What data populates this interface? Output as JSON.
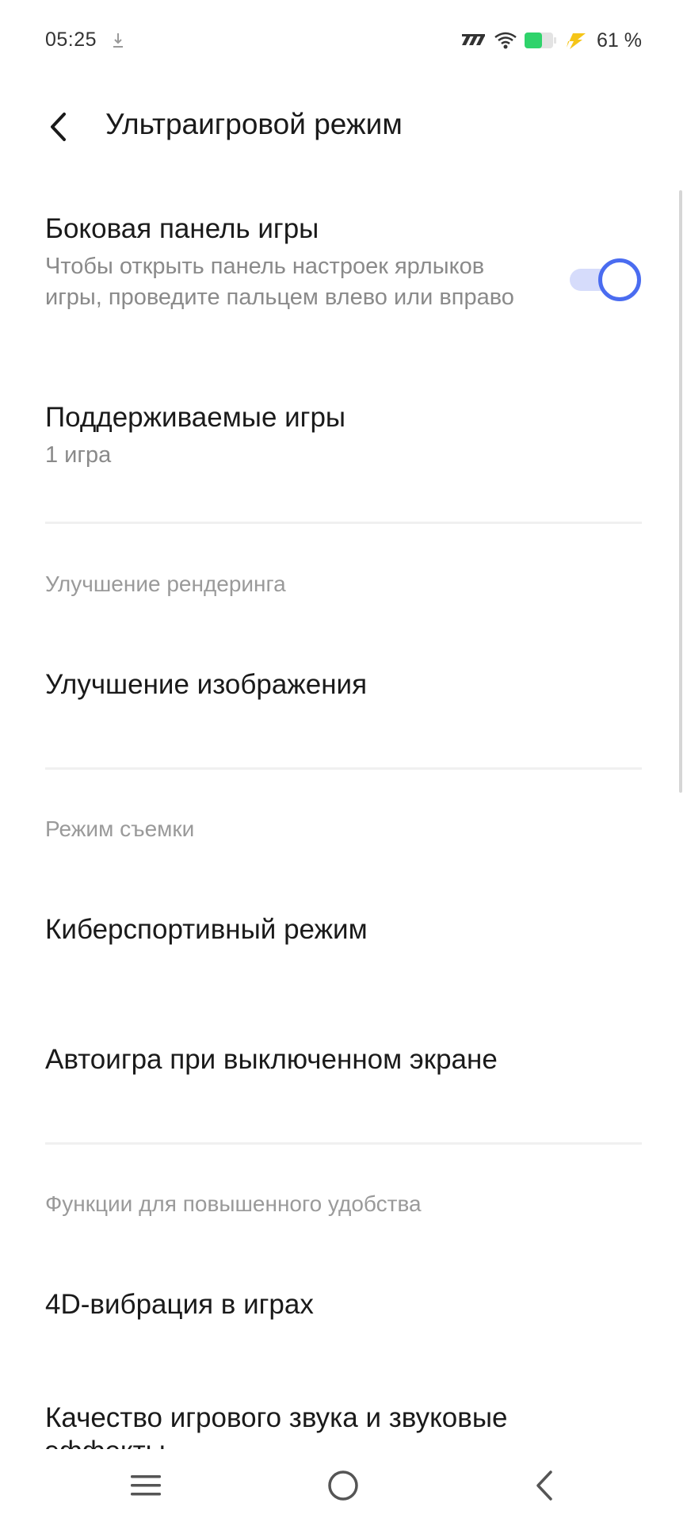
{
  "status_bar": {
    "time": "05:25",
    "battery_percent": "61 %",
    "battery_level": 0.61,
    "icons": [
      "download-icon",
      "signal-icon",
      "wifi-icon",
      "battery-icon",
      "charging-icon"
    ]
  },
  "header": {
    "title": "Ультраигровой режим",
    "back_icon": "chevron-left-icon"
  },
  "items": {
    "game_sidebar": {
      "title": "Боковая панель игры",
      "description": "Чтобы открыть панель настроек ярлыков игры, проведите пальцем влево или вправо",
      "toggle_on": true
    },
    "supported_games": {
      "title": "Поддерживаемые игры",
      "subtitle": "1 игра"
    },
    "image_enhancement": {
      "title": "Улучшение изображения"
    },
    "esports_mode": {
      "title": "Киберспортивный режим"
    },
    "auto_play": {
      "title": "Автоигра при выключенном экране"
    },
    "vibration_4d": {
      "title": "4D-вибрация в играх"
    },
    "sound_quality": {
      "title": "Качество игрового звука и звуковые эффекты"
    }
  },
  "sections": {
    "rendering": "Улучшение рендеринга",
    "shooting": "Режим съемки",
    "convenience": "Функции для повышенного удобства"
  },
  "colors": {
    "accent": "#4a6cf0",
    "toggle_track": "#d6dcfb",
    "battery_fill": "#2fd36b",
    "charging": "#f5c518"
  },
  "nav": {
    "icons": [
      "menu-icon",
      "home-circle-icon",
      "back-chevron-icon"
    ]
  }
}
